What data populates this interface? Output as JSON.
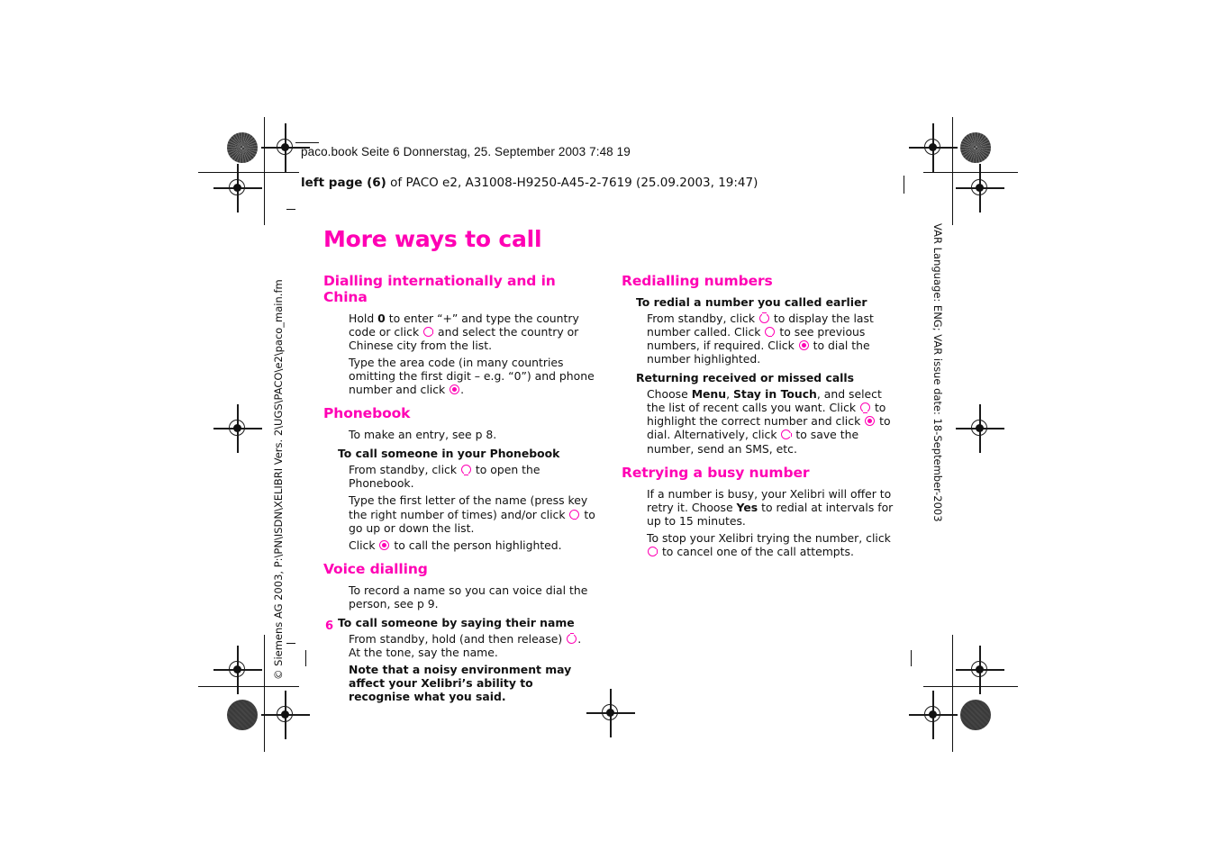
{
  "header": {
    "file_line": "paco.book  Seite 6  Donnerstag, 25. September 2003  7:48 19",
    "doc_line_bold": "left page (6)",
    "doc_line_rest": " of PACO e2, A31008-H9250-A45-2-7619 (25.09.2003, 19:47)"
  },
  "side_text": {
    "right": "VAR Language: ENG; VAR issue date: 18-September-2003",
    "left": "© Siemens AG 2003, P:\\PN\\ISDN\\XELIBRI Vers. 2\\UGS\\PACO\\e2\\paco_main.fm"
  },
  "page_number": "6",
  "title": "More ways to call",
  "colors": {
    "accent": "#ff00b4",
    "text": "#111111"
  },
  "left_column": [
    {
      "heading": "Dialling internationally and in China",
      "blocks": [
        {
          "type": "paragraph",
          "runs": [
            {
              "t": "Hold "
            },
            {
              "t": "0",
              "bold": true
            },
            {
              "t": " to enter “+” and type the country code or click "
            },
            {
              "icon": "side-key-icon"
            },
            {
              "t": " and select the country or Chinese city from the list."
            }
          ]
        },
        {
          "type": "paragraph",
          "runs": [
            {
              "t": "Type the area code (in many countries omitting the first digit – e.g. “0”) and phone number and click "
            },
            {
              "icon": "select-key-icon"
            },
            {
              "t": "."
            }
          ]
        }
      ]
    },
    {
      "heading": "Phonebook",
      "blocks": [
        {
          "type": "paragraph",
          "runs": [
            {
              "t": "To make an entry, see p 8."
            }
          ]
        },
        {
          "type": "subheading",
          "runs": [
            {
              "t": "To call someone in your Phonebook"
            }
          ]
        },
        {
          "type": "paragraph",
          "runs": [
            {
              "t": "From standby, click "
            },
            {
              "icon": "down-key-icon"
            },
            {
              "t": " to open the Phonebook."
            }
          ]
        },
        {
          "type": "paragraph",
          "runs": [
            {
              "t": "Type the first letter of the name (press key the right number of times) and/or click "
            },
            {
              "icon": "updown-key-icon"
            },
            {
              "t": " to go up or down the list."
            }
          ]
        },
        {
          "type": "paragraph",
          "runs": [
            {
              "t": "Click "
            },
            {
              "icon": "select-key-icon"
            },
            {
              "t": " to call the person highlighted."
            }
          ]
        }
      ]
    },
    {
      "heading": "Voice dialling",
      "blocks": [
        {
          "type": "paragraph",
          "runs": [
            {
              "t": "To record a name so you can voice dial the person, see p 9."
            }
          ]
        },
        {
          "type": "subheading",
          "runs": [
            {
              "t": "To call someone by saying their name"
            }
          ]
        },
        {
          "type": "paragraph",
          "runs": [
            {
              "t": "From standby, hold (and then release) "
            },
            {
              "icon": "up-key-icon"
            },
            {
              "t": ". At the tone, say the name."
            }
          ]
        },
        {
          "type": "note",
          "runs": [
            {
              "t": "Note that a noisy environment may affect your Xelibri’s ability to recognise what you said."
            }
          ]
        }
      ]
    }
  ],
  "right_column": [
    {
      "heading": "Redialling numbers",
      "blocks": [
        {
          "type": "subheading",
          "runs": [
            {
              "t": "To redial a number you called earlier"
            }
          ]
        },
        {
          "type": "paragraph",
          "runs": [
            {
              "t": "From standby, click "
            },
            {
              "icon": "up-key-icon"
            },
            {
              "t": " to display the last number called. Click "
            },
            {
              "icon": "down-key-icon"
            },
            {
              "t": " to see previous numbers, if required. Click "
            },
            {
              "icon": "select-key-icon"
            },
            {
              "t": " to dial the number highlighted."
            }
          ]
        },
        {
          "type": "subheading",
          "runs": [
            {
              "t": "Returning received or missed calls"
            }
          ]
        },
        {
          "type": "paragraph",
          "runs": [
            {
              "t": "Choose "
            },
            {
              "t": "Menu",
              "bold": true
            },
            {
              "t": ", "
            },
            {
              "t": "Stay in Touch",
              "bold": true
            },
            {
              "t": ", and select the list of recent calls you want. Click "
            },
            {
              "icon": "updown-key-icon"
            },
            {
              "t": " to highlight the correct number and click "
            },
            {
              "icon": "select-key-icon"
            },
            {
              "t": " to dial. Alternatively, click "
            },
            {
              "icon": "side-key-icon"
            },
            {
              "t": " to save the number, send an SMS, etc."
            }
          ]
        }
      ]
    },
    {
      "heading": "Retrying a busy number",
      "blocks": [
        {
          "type": "paragraph",
          "runs": [
            {
              "t": "If a number is busy, your Xelibri will offer to retry it. Choose "
            },
            {
              "t": "Yes",
              "bold": true
            },
            {
              "t": " to redial at intervals for up to 15 minutes."
            }
          ]
        },
        {
          "type": "paragraph",
          "runs": [
            {
              "t": "To stop your Xelibri trying the number, click "
            },
            {
              "icon": "side-key-icon"
            },
            {
              "t": " to cancel one of the call attempts."
            }
          ]
        }
      ]
    }
  ]
}
